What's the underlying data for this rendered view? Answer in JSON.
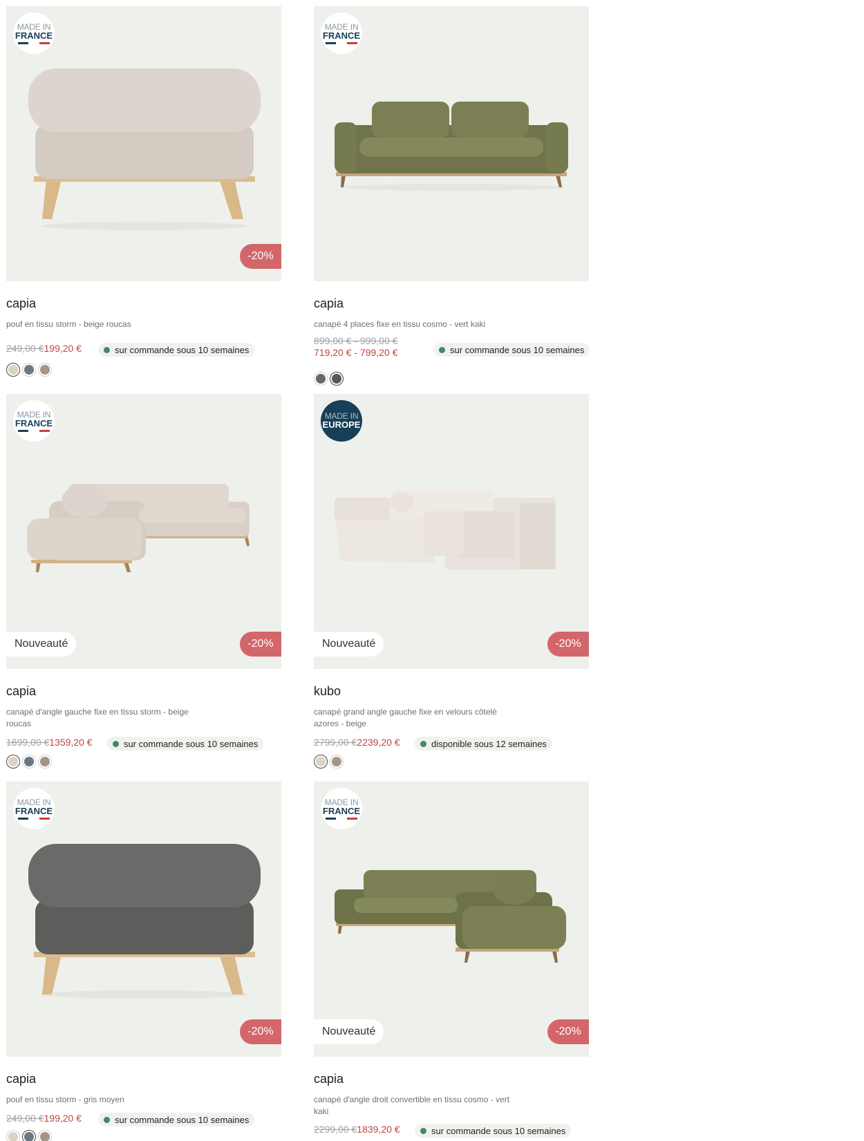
{
  "products": [
    {
      "name": "capia",
      "description": "pouf en tissu storm - beige roucas",
      "made_in": {
        "top": "MADE IN",
        "country": "FRANCE",
        "style": "light"
      },
      "badge_new": "",
      "discount": "-20%",
      "old_price": "249,00 €",
      "new_price": "199,20 €",
      "availability": "sur commande sous 10 semaines",
      "swatches": [
        "#dcd3c4",
        "#6b7884",
        "#a59684"
      ],
      "selected_swatch": 0,
      "image_icon": "ottoman-beige"
    },
    {
      "name": "capia",
      "description": "canapé 4 places fixe en tissu cosmo - vert kaki",
      "made_in": {
        "top": "MADE IN",
        "country": "FRANCE",
        "style": "light"
      },
      "badge_new": "",
      "discount": "",
      "old_price": "899,00 € - 999,00 €",
      "new_price": "719,20 € - 799,20 €",
      "availability": "sur commande sous 10 semaines",
      "swatches": [
        "#666a6b",
        "#545a55"
      ],
      "selected_swatch": 1,
      "image_icon": "sofa-khaki"
    },
    {
      "name": "capia",
      "description": "canapé d'angle gauche fixe en tissu storm - beige roucas",
      "made_in": {
        "top": "MADE IN",
        "country": "FRANCE",
        "style": "light"
      },
      "badge_new": "Nouveauté",
      "discount": "-20%",
      "old_price": "1699,00 €",
      "new_price": "1359,20 €",
      "availability": "sur commande sous 10 semaines",
      "swatches": [
        "#dcd3c4",
        "#6b7884",
        "#a59684"
      ],
      "selected_swatch": 0,
      "image_icon": "corner-sofa-beige"
    },
    {
      "name": "kubo",
      "description": "canapé grand angle gauche fixe en velours côtelé azores - beige",
      "made_in": {
        "top": "MADE IN",
        "country": "EUROPE",
        "style": "dark"
      },
      "badge_new": "Nouveauté",
      "discount": "-20%",
      "old_price": "2799,00 €",
      "new_price": "2239,20 €",
      "availability": "disponible sous 12 semaines",
      "swatches": [
        "#dcd3c4",
        "#a59684"
      ],
      "selected_swatch": 0,
      "image_icon": "corner-sofa-corduroy"
    },
    {
      "name": "capia",
      "description": "pouf en tissu storm - gris moyen",
      "made_in": {
        "top": "MADE IN",
        "country": "FRANCE",
        "style": "light"
      },
      "badge_new": "",
      "discount": "-20%",
      "old_price": "249,00 €",
      "new_price": "199,20 €",
      "availability": "sur commande sous 10 semaines",
      "swatches": [
        "#dcd3c4",
        "#6b7884",
        "#a59684"
      ],
      "selected_swatch": 1,
      "image_icon": "ottoman-grey"
    },
    {
      "name": "capia",
      "description": "canapé d'angle droit convertible en tissu cosmo - vert kaki",
      "made_in": {
        "top": "MADE IN",
        "country": "FRANCE",
        "style": "light"
      },
      "badge_new": "Nouveauté",
      "discount": "-20%",
      "old_price": "2299,00 €",
      "new_price": "1839,20 €",
      "availability": "sur commande sous 10 semaines",
      "swatches": [],
      "selected_swatch": -1,
      "image_icon": "corner-sofa-khaki"
    }
  ],
  "colors": {
    "discount": "#d3666a",
    "sale_price": "#c0463f",
    "available_dot": "#3d8a68",
    "photo_bg": "#eef0ec",
    "flag_blue": "#173f57",
    "flag_red": "#d23a3a"
  }
}
